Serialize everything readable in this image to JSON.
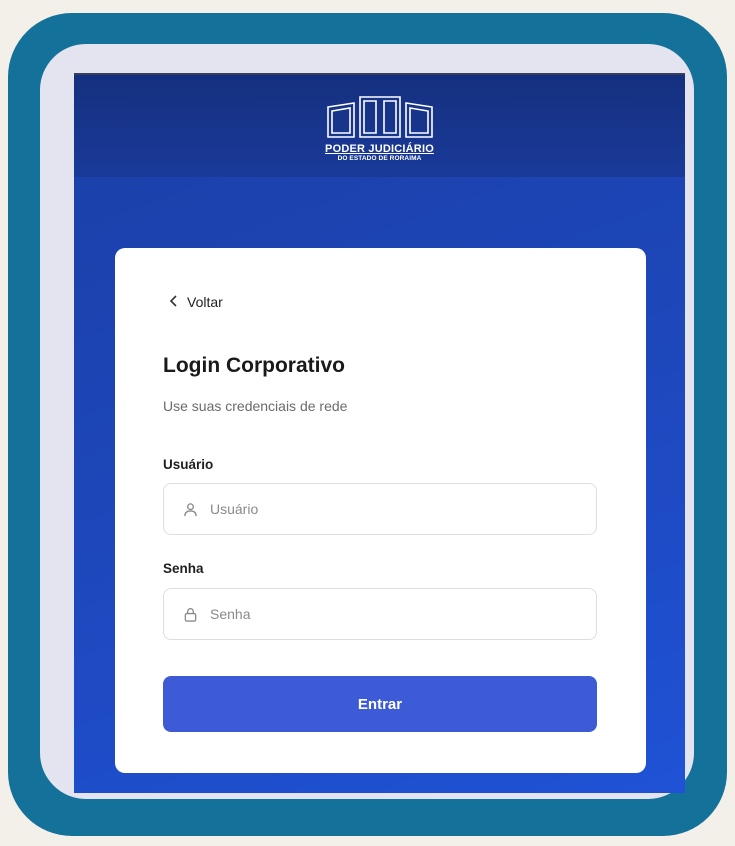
{
  "header": {
    "logo_title": "PODER JUDICIÁRIO",
    "logo_subtitle": "DO ESTADO DE RORAIMA"
  },
  "login": {
    "back_label": "Voltar",
    "title": "Login Corporativo",
    "subtitle": "Use suas credenciais de rede",
    "username": {
      "label": "Usuário",
      "placeholder": "Usuário",
      "value": "",
      "icon": "user-icon"
    },
    "password": {
      "label": "Senha",
      "placeholder": "Senha",
      "value": "",
      "icon": "lock-icon"
    },
    "submit_label": "Entrar"
  },
  "colors": {
    "frame_outer": "#13719a",
    "frame_inner": "#e4e4f1",
    "screen_blue": "#1d46b8",
    "button_blue": "#3d5bd6"
  }
}
